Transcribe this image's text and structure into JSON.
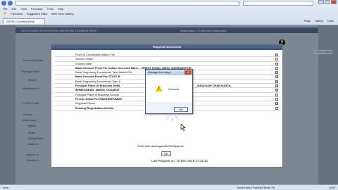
{
  "browser": {
    "menu": [
      "File",
      "Edit",
      "View",
      "Favorites",
      "Tools",
      "Help"
    ],
    "favorites_label": "Favorites",
    "fav_links": [
      "Suggested Sites",
      "Web Slice Gallery"
    ],
    "tab_title": "GSTN | CommonDesk",
    "tools": [
      "Page",
      "Safety",
      "Tools"
    ]
  },
  "page": {
    "banner_left": "GOODS AND SERVICES TAX NETWORK COMMON DESK",
    "banner_right": "Registration > Enrolment Information",
    "side_labels": [
      "Personal Details",
      "Principal Place",
      "Mobile",
      "Additional Pla",
      "GSTIN Code",
      "Contact",
      "Authorised",
      "Name",
      "Email",
      "Designation",
      "Address",
      "Nature of",
      "Details of"
    ],
    "side_link": "Check Status",
    "close_symbol": "×"
  },
  "modal": {
    "title": "Required Documents",
    "rows": [
      {
        "label": "Proof of Constitution Attach File",
        "checked": true,
        "bold": false
      },
      {
        "label": "Service Detail",
        "checked": false,
        "bold": false
      },
      {
        "label": "Goods Detail",
        "checked": true,
        "bold": false
      },
      {
        "label": "Bank Account Proof For Indian Overseas Bank, ...RNEST ROAD, 38001, NAVRANGPUR",
        "checked": false,
        "bold": true
      },
      {
        "label": "Bank Supporting Documents Type Attach File",
        "checked": true,
        "bold": false
      },
      {
        "label": "Bank Account Proof For STATE B",
        "checked": true,
        "bold": true
      },
      {
        "label": "Bank Supporting Documents Type A",
        "checked": true,
        "bold": false
      },
      {
        "label": "Principal Place of Business Detai",
        "checked": true,
        "bold": true,
        "tail": "...NAVAGAM CHAR RASTA,"
      },
      {
        "label": "AHMEDABAD, 380006, GUJARAT",
        "checked": true,
        "bold": true
      },
      {
        "label": "Principal Place of Business Docum",
        "checked": false,
        "bold": false
      },
      {
        "label": "Person Detail For RAKESHKUMAR",
        "checked": false,
        "bold": true
      },
      {
        "label": "Regestar Photo",
        "checked": true,
        "bold": false
      },
      {
        "label": "Existing Registration Details",
        "checked": false,
        "bold": true
      }
    ],
    "email_line": "Send Mail rakeshgandhi1969@gmail",
    "ok_label": "OK",
    "last_request": "Last Request on :10-Dec-2016 17:12:42"
  },
  "msgbox": {
    "title": "Message from webp...",
    "close": "✕",
    "icon": "warning-icon",
    "text": "Success",
    "ok_label": "OK"
  },
  "status": {
    "text": "Done",
    "zone": "Trusted sites | Protected Mode: Off",
    "zoom": "100%"
  }
}
